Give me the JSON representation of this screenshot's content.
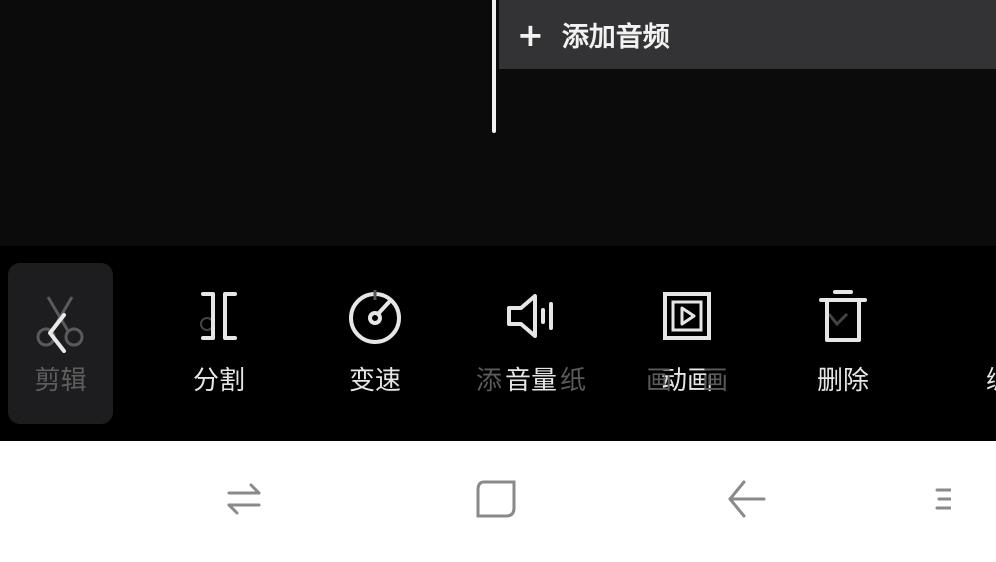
{
  "timeline": {
    "add_audio_plus": "+",
    "add_audio_label": "添加音频"
  },
  "toolbar": {
    "back": {
      "label": "剪辑",
      "icon": "back-chevron-icon"
    },
    "tools": [
      {
        "label": "分割",
        "icon": "split-icon"
      },
      {
        "label": "变速",
        "icon": "speed-icon"
      },
      {
        "label": "音量",
        "icon": "volume-icon"
      },
      {
        "label": "动画",
        "icon": "animation-icon"
      },
      {
        "label": "删除",
        "icon": "delete-icon"
      },
      {
        "label": "编",
        "icon": "edit-icon"
      }
    ],
    "ghost_left": "添",
    "ghost_right": "纸",
    "ghost_anim_left": "画",
    "ghost_anim_right": "画"
  },
  "navbar": {
    "buttons": [
      "switch-apps-icon",
      "home-icon",
      "back-icon",
      "menu-icon"
    ]
  },
  "colors": {
    "background": "#0b0b0c",
    "toolbar": "#000000",
    "add_audio_bg": "#333335",
    "text": "#e6e6e6",
    "navbar": "#ffffff"
  }
}
